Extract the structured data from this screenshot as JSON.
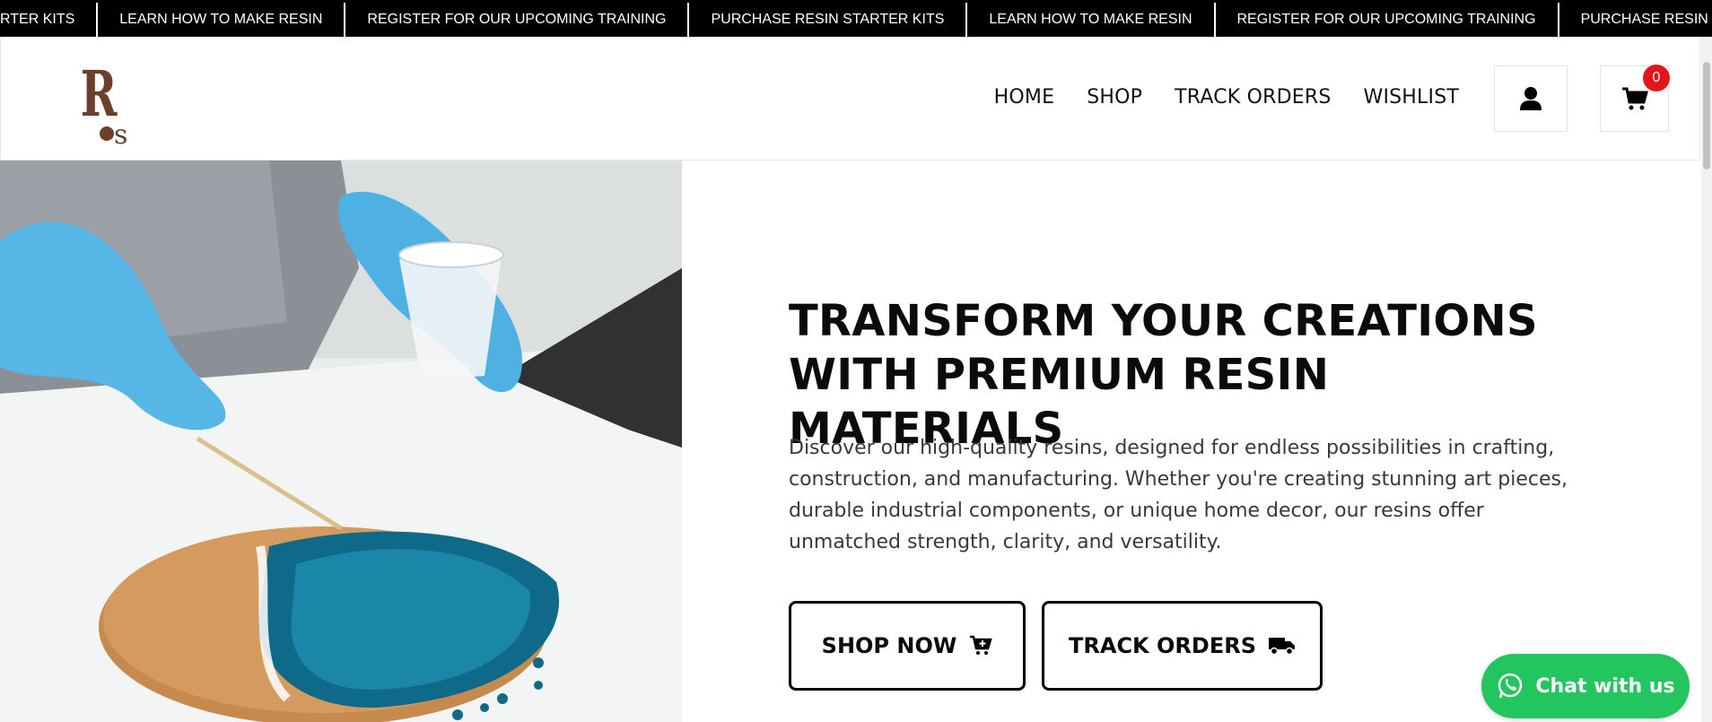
{
  "ticker": {
    "items": [
      "RTER KITS",
      "LEARN HOW TO MAKE RESIN",
      "REGISTER FOR OUR UPCOMING TRAINING",
      "PURCHASE RESIN STARTER KITS",
      "LEARN HOW TO MAKE RESIN",
      "REGISTER FOR OUR UPCOMING TRAINING",
      "PURCHASE RESIN STARTER KI"
    ]
  },
  "header": {
    "logo": {
      "text_top": "R",
      "text_bottom": "os",
      "color": "#6b3f2a"
    },
    "nav": [
      "HOME",
      "SHOP",
      "TRACK ORDERS",
      "WISHLIST"
    ],
    "cart_count": "0",
    "icons": {
      "account": "user-icon",
      "cart": "cart-icon"
    }
  },
  "hero": {
    "title": "TRANSFORM YOUR CREATIONS WITH PREMIUM RESIN MATERIALS",
    "description": "Discover our high-quality resins, designed for endless possibilities in crafting, construction, and manufacturing. Whether you're creating stunning art pieces, durable industrial components, or unique home decor, our resins offer unmatched strength, clarity, and versatility.",
    "buttons": {
      "shop": {
        "label": "SHOP NOW",
        "icon": "cart-plus-icon"
      },
      "track": {
        "label": "TRACK ORDERS",
        "icon": "truck-icon"
      }
    }
  },
  "chat": {
    "label": "Chat with us",
    "icon": "whatsapp-icon",
    "color": "#22c55e"
  },
  "colors": {
    "ticker_bg": "#000000",
    "badge": "#e0161b"
  }
}
